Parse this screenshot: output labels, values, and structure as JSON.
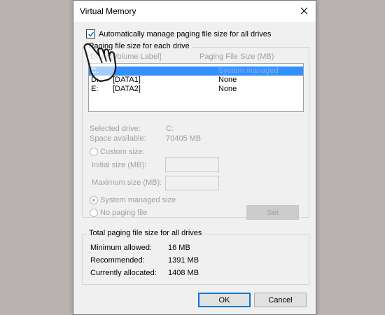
{
  "window": {
    "title": "Virtual Memory"
  },
  "auto_manage": {
    "label": "Automatically manage paging file size for all drives",
    "checked": true
  },
  "drives_group": {
    "label": "Paging file size for each drive",
    "header_drive": "Drive [Volume Label]",
    "header_size": "Paging File Size (MB)",
    "rows": [
      {
        "drive": "C:",
        "label": "",
        "size": "System managed",
        "selected": true
      },
      {
        "drive": "D:",
        "label": "[DATA1]",
        "size": "None",
        "selected": false
      },
      {
        "drive": "E:",
        "label": "[DATA2]",
        "size": "None",
        "selected": false
      }
    ]
  },
  "selected_drive": {
    "label": "Selected drive:",
    "value": "C:"
  },
  "space_available": {
    "label": "Space available:",
    "value": "70405 MB"
  },
  "custom_size": {
    "label": "Custom size:"
  },
  "initial_size": {
    "label": "Initial size (MB):",
    "value": ""
  },
  "maximum_size": {
    "label": "Maximum size (MB):",
    "value": ""
  },
  "system_managed": {
    "label": "System managed size"
  },
  "no_paging": {
    "label": "No paging file"
  },
  "set_button": {
    "label": "Set"
  },
  "totals_group": {
    "label": "Total paging file size for all drives",
    "minimum": {
      "label": "Minimum allowed:",
      "value": "16 MB"
    },
    "recommended": {
      "label": "Recommended:",
      "value": "1391 MB"
    },
    "allocated": {
      "label": "Currently allocated:",
      "value": "1408 MB"
    }
  },
  "ok_button": {
    "label": "OK"
  },
  "cancel_button": {
    "label": "Cancel"
  },
  "colors": {
    "background": "#b9b2b0",
    "dialog": "#f0f0f0",
    "selection": "#3390ff",
    "check": "#0078d7"
  }
}
